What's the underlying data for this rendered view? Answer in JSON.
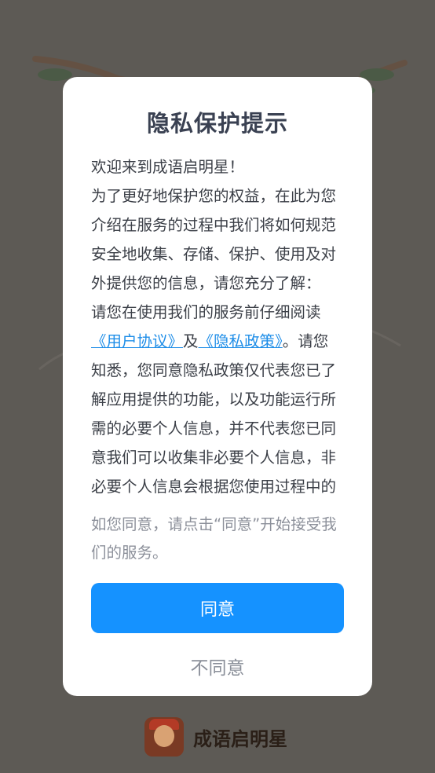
{
  "dialog": {
    "title": "隐私保护提示",
    "greeting": "欢迎来到成语启明星！",
    "paragraph1": "为了更好地保护您的权益，在此为您介绍在服务的过程中我们将如何规范安全地收集、存储、保护、使用及对外提供您的信息，请您充分了解：",
    "para2_prefix": "请您在使用我们的服务前仔细阅读",
    "user_agreement_link": "《用户协议》",
    "and": "及",
    "privacy_policy_link": "《隐私政策》",
    "para2_suffix": "。请您知悉，您同意隐私政策仅代表您已了解应用提供的功能，以及功能运行所需的必要个人信息，并不代表您已同意我们可以收集非必要个人信息，非必要个人信息会根据您使用过程中的",
    "notice": "如您同意，请点击“同意”开始接受我们的服务。",
    "agree_label": "同意",
    "disagree_label": "不同意"
  },
  "footer": {
    "app_name": "成语启明星",
    "logo_icon": "app-logo-icon"
  },
  "colors": {
    "accent": "#1592ff",
    "link": "#1f8ee8",
    "background_dim": "#5d5a55"
  }
}
